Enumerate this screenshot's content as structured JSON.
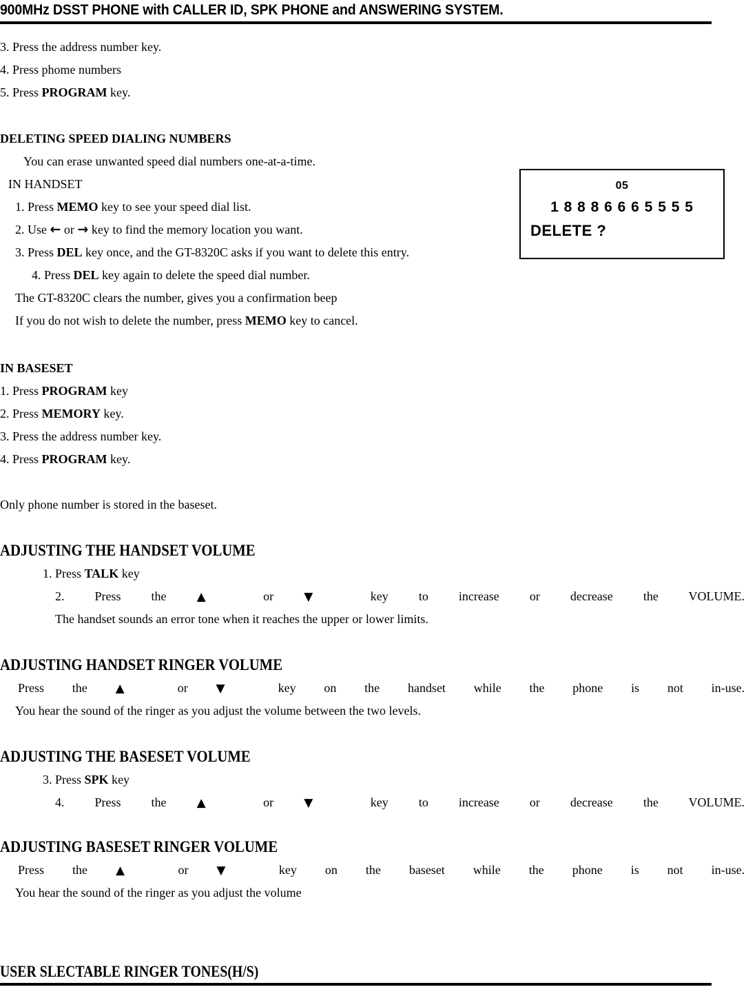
{
  "document": {
    "header_title": "900MHz DSST PHONE with CALLER ID, SPK PHONE and ANSWERING SYSTEM.",
    "footer_title": "USER SLECTABLE RINGER TONES(H/S)"
  },
  "steps_continued": {
    "line_3": "3. Press the address number key.",
    "line_4": "4. Press phome numbers",
    "line_5_pre": "5. Press ",
    "line_5_key": "PROGRAM",
    "line_5_post": " key."
  },
  "deleting": {
    "heading": "DELETING SPEED DIALING NUMBERS",
    "intro": "You can erase unwanted speed dial numbers one-at-a-time.",
    "subheading": "IN HANDSET",
    "item1_pre": "1.  Press ",
    "item1_key": "MEMO",
    "item1_post": " key to see your speed dial list.",
    "item2_pre": "2.  Use ",
    "item2_arrow_left": "←",
    "item2_mid": " or ",
    "item2_arrow_right": "→",
    "item2_post": " key to find the memory location you want.",
    "item3_pre": "3.  Press ",
    "item3_key": "DEL",
    "item3_post": " key once, and the GT-8320C asks if you want to delete this entry.",
    "item4_pre": "4.  Press ",
    "item4_key": "DEL",
    "item4_post": " key again to delete the speed dial number.",
    "note1": "The GT-8320C clears the number, gives you a confirmation beep",
    "note2_pre": "If you do not wish to delete the number, press ",
    "note2_key": "MEMO",
    "note2_post": " key to cancel."
  },
  "lcd": {
    "memory_location": "05",
    "phone_number": "1 8 8 8 6 6 6 5 5 5 5",
    "prompt": "DELETE ?"
  },
  "in_baseset": {
    "heading": "IN BASESET",
    "step1_pre": "1. Press ",
    "step1_key": "PROGRAM",
    "step1_post": " key",
    "step2_pre": "2. Press ",
    "step2_key": "MEMORY",
    "step2_post": " key.",
    "step3": "3. Press the address number key.",
    "step4_pre": "4. Press ",
    "step4_key": "PROGRAM",
    "step4_post": " key.",
    "note": "Only phone number is stored in the baseset."
  },
  "handset_volume": {
    "heading": "ADJUSTING THE HANDSET VOLUME",
    "step1_pre": "1. Press ",
    "step1_key": "TALK",
    "step1_post": " key",
    "step2_words": [
      "2. Press",
      "the",
      "▲",
      "or",
      "▼",
      "key",
      "to",
      "increase",
      "or",
      "decrease",
      "the",
      "VOLUME."
    ],
    "note": "The handset sounds an error tone when it reaches the upper or lower limits."
  },
  "handset_ringer": {
    "heading": "ADJUSTING HANDSET RINGER VOLUME",
    "line_words": [
      "Press",
      "the",
      "▲",
      "or",
      "▼",
      "key",
      "on",
      "the",
      "handset",
      "while",
      "the",
      "phone",
      "is",
      "not",
      "in-use."
    ],
    "note": "You hear the sound of the ringer as you adjust the volume between the two levels."
  },
  "baseset_volume": {
    "heading": "ADJUSTING THE BASESET VOLUME",
    "step3_pre": "3. Press ",
    "step3_key": "SPK",
    "step3_post": " key",
    "step4_words": [
      "4. Press",
      "the",
      "▲",
      "or",
      "▼",
      "key",
      "to",
      "increase",
      "or",
      "decrease",
      "the",
      "VOLUME."
    ]
  },
  "baseset_ringer": {
    "heading": "ADJUSTING BASESET RINGER VOLUME",
    "line_words": [
      "Press",
      "the",
      "▲",
      "or",
      "▼",
      "key",
      "on",
      "the",
      "baseset",
      "while",
      "the",
      "phone",
      "is",
      "not",
      "in-use."
    ],
    "note": "You hear the sound of the ringer as you adjust the volume"
  }
}
